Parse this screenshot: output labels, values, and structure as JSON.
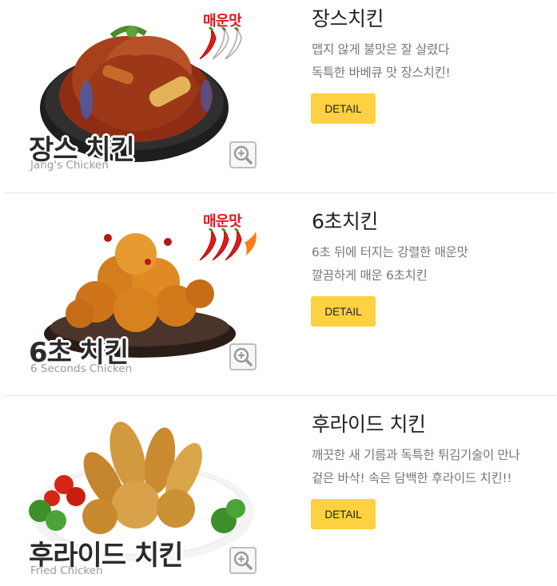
{
  "colors": {
    "detail_button": "#fdd13f",
    "spicy_label": "#e8121b",
    "divider": "#e6e6e6"
  },
  "menu": [
    {
      "title": "장스치킨",
      "desc_line1": "맵지 않게 불맛은 잘 살렸다",
      "desc_line2": "독특한 바베큐 맛 장스치킨!",
      "image_title": "장스 치킨",
      "image_subtitle": "Jang's Chicken",
      "spicy_label": "매운맛",
      "spicy_level": 1,
      "detail_label": "DETAIL",
      "zoom_icon": "zoom-in-icon"
    },
    {
      "title": "6초치킨",
      "desc_line1": "6초 뒤에 터지는 강렬한 매운맛",
      "desc_line2": "깔끔하게 매운 6초치킨",
      "image_title": "6초 치킨",
      "image_subtitle": "6 Seconds Chicken",
      "spicy_label": "매운맛",
      "spicy_level": 3,
      "detail_label": "DETAIL",
      "zoom_icon": "zoom-in-icon"
    },
    {
      "title": "후라이드 치킨",
      "desc_line1": "깨끗한 새 기름과 독특한 튀김기술이 만나",
      "desc_line2": "겉은 바삭! 속은 담백한 후라이드 치킨!!",
      "image_title": "후라이드 치킨",
      "image_subtitle": "Fried Chicken",
      "detail_label": "DETAIL",
      "zoom_icon": "zoom-in-icon"
    }
  ]
}
